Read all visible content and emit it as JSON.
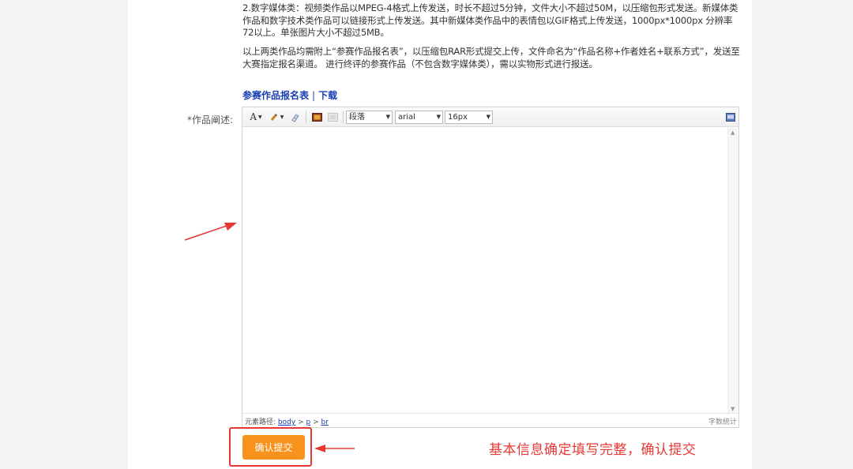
{
  "instructions": {
    "p1": "2.数字媒体类：视频类作品以MPEG-4格式上传发送，时长不超过5分钟，文件大小不超过50M，以压缩包形式发送。新媒体类作品和数字技术类作品可以链接形式上传发送。其中新媒体类作品中的表情包以GIF格式上传发送，1000px*1000px 分辨率72以上。单张图片大小不超过5MB。",
    "p2": "以上两类作品均需附上“参赛作品报名表”，以压缩包RAR形式提交上传，文件命名为“作品名称+作者姓名+联系方式”，发送至大赛指定报名渠道。 进行终评的参赛作品（不包含数字媒体类），需以实物形式进行报送。"
  },
  "links": {
    "form": "参赛作品报名表",
    "separator": "|",
    "download": "下载"
  },
  "form": {
    "description_label": "*作品阐述:"
  },
  "editor": {
    "toolbar": {
      "font_color_glyph": "A",
      "paragraph_select": "段落",
      "font_select": "arial",
      "size_select": "16px"
    },
    "status": {
      "path_label": "元素路径:",
      "path": [
        "body",
        "p",
        "br"
      ],
      "path_sep": ">",
      "word_count_label": "字数统计"
    }
  },
  "submit": {
    "label": "确认提交"
  },
  "annotation": {
    "text": "基本信息确定填写完整，确认提交",
    "color": "#e53935"
  },
  "colors": {
    "accent": "#f7931d",
    "link": "#1a3fb0"
  }
}
